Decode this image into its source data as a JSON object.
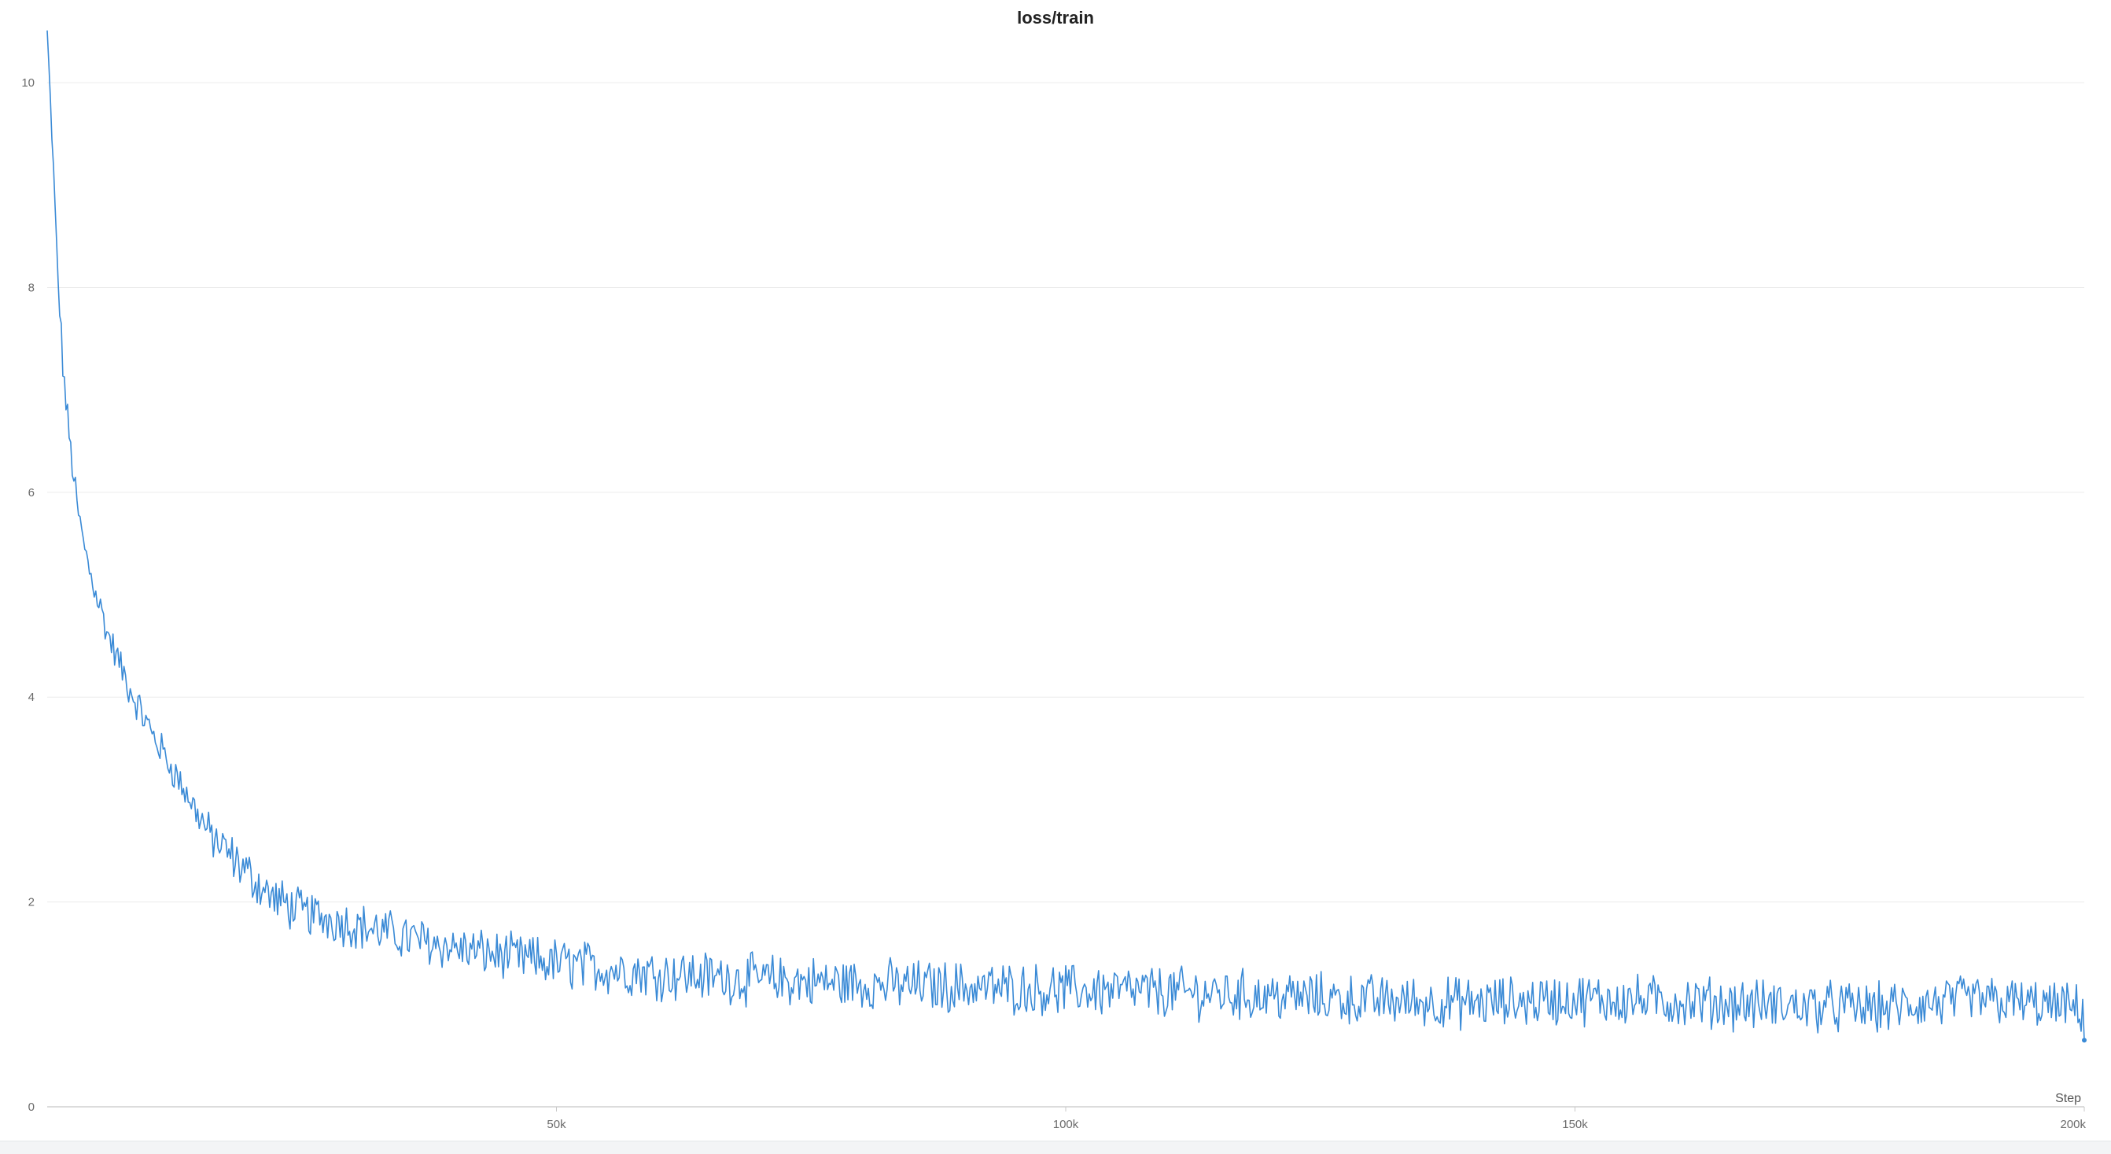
{
  "chart_data": {
    "type": "line",
    "title": "loss/train",
    "xlabel": "Step",
    "ylabel": "",
    "xlim": [
      0,
      200000
    ],
    "ylim": [
      0,
      10.5
    ],
    "x_ticks": [
      {
        "value": 50000,
        "label": "50k"
      },
      {
        "value": 100000,
        "label": "100k"
      },
      {
        "value": 150000,
        "label": "150k"
      },
      {
        "value": 200000,
        "label": "200k"
      }
    ],
    "y_ticks": [
      {
        "value": 0,
        "label": "0"
      },
      {
        "value": 2,
        "label": "2"
      },
      {
        "value": 4,
        "label": "4"
      },
      {
        "value": 6,
        "label": "6"
      },
      {
        "value": 8,
        "label": "8"
      },
      {
        "value": 10,
        "label": "10"
      }
    ],
    "grid": true,
    "series": [
      {
        "color": "#3a8ad6",
        "x": [
          0,
          500,
          1000,
          1500,
          2000,
          3000,
          4000,
          5000,
          6000,
          8000,
          10000,
          12000,
          14000,
          16000,
          18000,
          20000,
          22000,
          25000,
          30000,
          35000,
          40000,
          45000,
          50000,
          60000,
          70000,
          80000,
          90000,
          100000,
          110000,
          120000,
          130000,
          140000,
          150000,
          160000,
          170000,
          180000,
          190000,
          200000
        ],
        "values": [
          10.5,
          9.4,
          8.2,
          7.3,
          6.7,
          5.8,
          5.3,
          4.95,
          4.6,
          4.1,
          3.7,
          3.35,
          3.0,
          2.65,
          2.45,
          2.25,
          2.05,
          1.9,
          1.78,
          1.66,
          1.55,
          1.47,
          1.4,
          1.3,
          1.24,
          1.2,
          1.17,
          1.14,
          1.12,
          1.08,
          1.04,
          1.01,
          1.05,
          1.03,
          0.99,
          0.96,
          1.05,
          0.95
        ],
        "noise_amplitude": [
          0.05,
          0.1,
          0.15,
          0.15,
          0.15,
          0.15,
          0.15,
          0.15,
          0.15,
          0.15,
          0.15,
          0.15,
          0.15,
          0.18,
          0.2,
          0.2,
          0.2,
          0.2,
          0.2,
          0.2,
          0.2,
          0.2,
          0.22,
          0.22,
          0.22,
          0.22,
          0.22,
          0.22,
          0.22,
          0.22,
          0.22,
          0.22,
          0.22,
          0.22,
          0.22,
          0.22,
          0.22,
          0.2
        ],
        "last_value": 0.65
      }
    ]
  }
}
